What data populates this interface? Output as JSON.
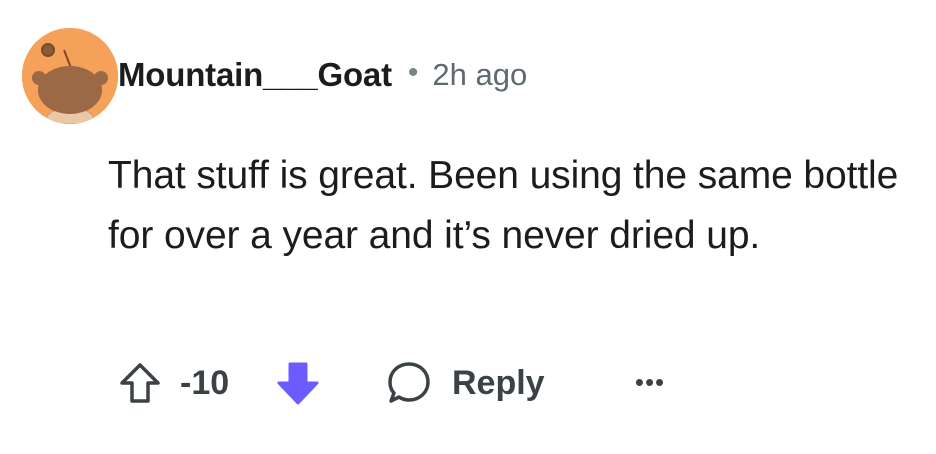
{
  "comment": {
    "username": "Mountain___Goat",
    "separator": "•",
    "timestamp": "2h ago",
    "body": "That stuff is great. Been using the same bottle for over a year and it’s never dried up.",
    "score": "-10",
    "reply_label": "Reply",
    "more_label": "•••"
  },
  "colors": {
    "avatar_bg": "#f6a15a",
    "downvote_active": "#6a5cff",
    "text": "#1c1c1c",
    "muted": "#5f6a6e"
  },
  "icons": {
    "upvote": "upvote-arrow-icon",
    "downvote": "downvote-arrow-icon",
    "reply": "speech-bubble-icon",
    "more": "ellipsis-icon",
    "avatar": "snoo-avatar-icon"
  }
}
